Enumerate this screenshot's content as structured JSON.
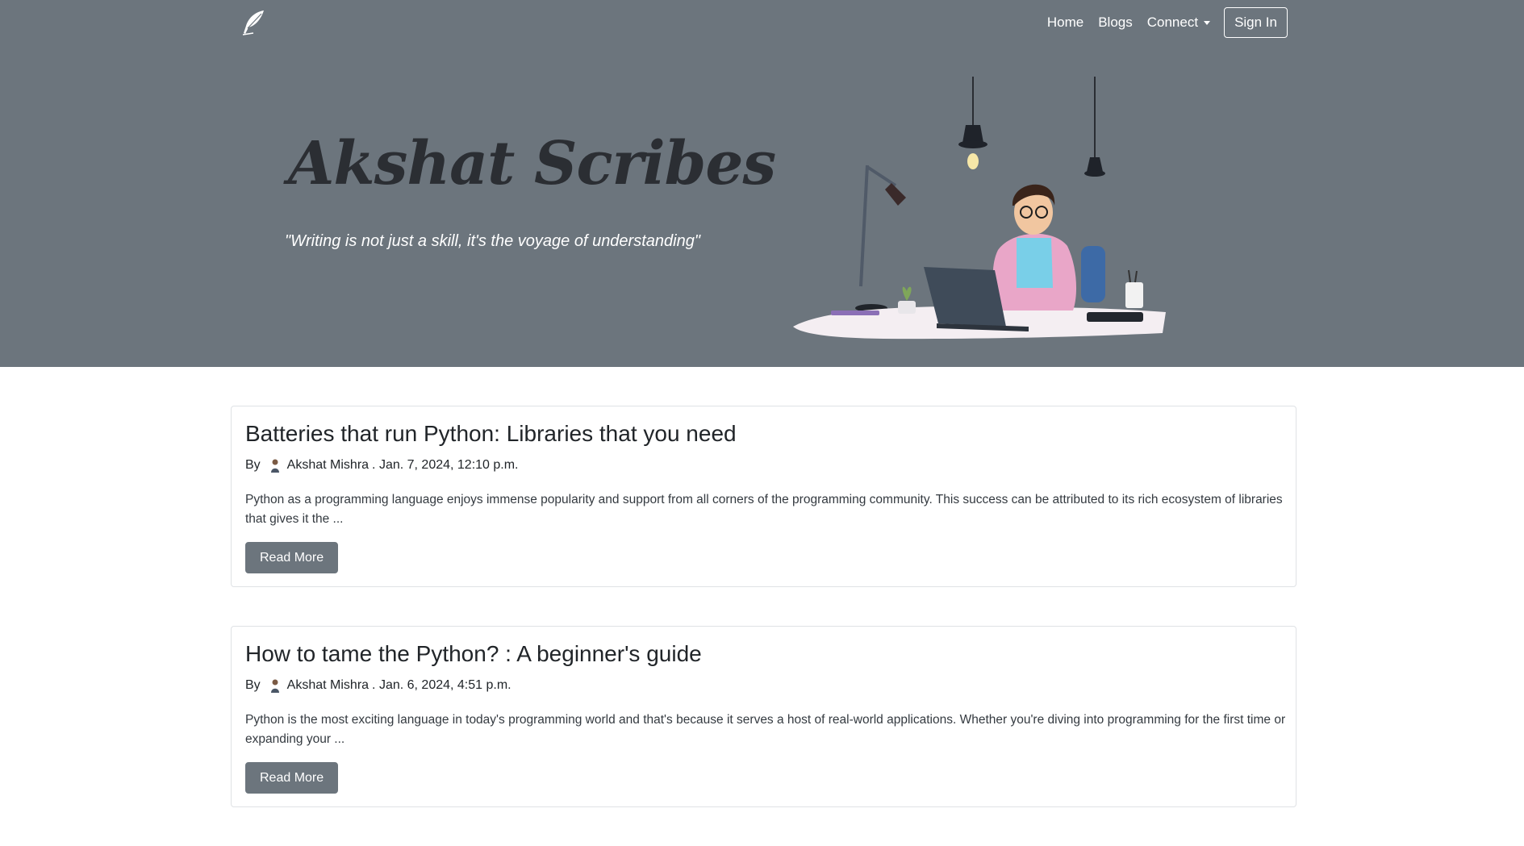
{
  "nav": {
    "logo_icon": "quill-feather-icon",
    "links": [
      {
        "label": "Home"
      },
      {
        "label": "Blogs"
      },
      {
        "label": "Connect"
      }
    ],
    "signin_label": "Sign In"
  },
  "hero": {
    "title": "Akshat Scribes",
    "tagline": "\"Writing is not just a skill, it's the voyage of understanding\"",
    "illustration": "person-at-desk-with-laptop-illustration"
  },
  "posts": [
    {
      "title": "Batteries that run Python: Libraries that you need",
      "by": "By",
      "author": "Akshat Mishra",
      "date": ". Jan. 7, 2024, 12:10 p.m.",
      "excerpt": "Python as a programming language enjoys immense popularity and support from all corners of the programming community. This success can be attributed to its rich ecosystem of libraries that gives it the ...",
      "button": "Read More"
    },
    {
      "title": "How to tame the Python? : A beginner's guide",
      "by": "By",
      "author": "Akshat Mishra",
      "date": ". Jan. 6, 2024, 4:51 p.m.",
      "excerpt": "Python is the most exciting language in today's programming world and that's because it serves a host of real-world applications. Whether you're diving into programming for the first time or expanding your ...",
      "button": "Read More"
    }
  ],
  "colors": {
    "hero_bg": "#6c757d",
    "button_bg": "#6c757d",
    "title_dark": "#2b2e33"
  }
}
